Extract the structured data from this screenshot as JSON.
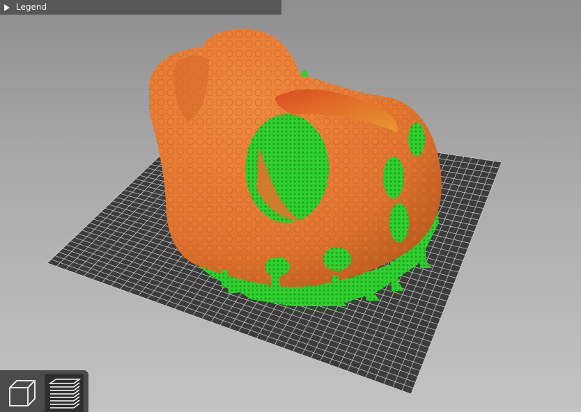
{
  "legend": {
    "label": "Legend",
    "expanded": false,
    "icon": "triangle-right-icon"
  },
  "view_toolbar": {
    "buttons": [
      {
        "name": "3d-view",
        "icon": "cube-icon",
        "active": false
      },
      {
        "name": "preview-view",
        "icon": "layers-icon",
        "active": true
      }
    ]
  },
  "colors": {
    "model_shell": "#e0742e",
    "support": "#2fd12f",
    "bed_grid": "#3a3a3a",
    "bed_lines": "#d9d9d9",
    "background_top": "#8e8e8e",
    "background_bottom": "#c3c3c3",
    "overhang": "#c8321e"
  }
}
